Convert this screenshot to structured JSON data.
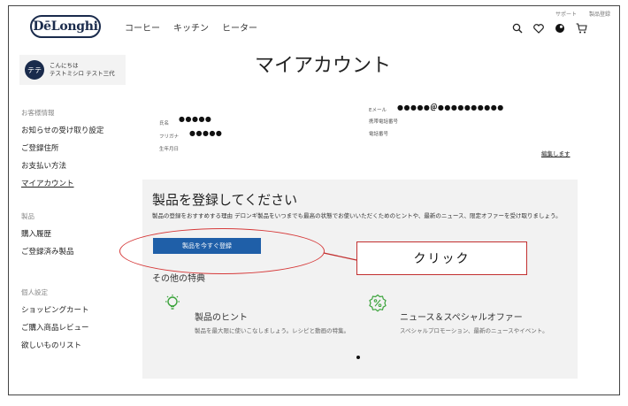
{
  "header": {
    "logo": "DēLonghi",
    "nav": [
      "コーヒー",
      "キッチン",
      "ヒーター"
    ],
    "top_links": [
      "サポート",
      "製品登録"
    ]
  },
  "sidebar": {
    "greeting": {
      "avatar": "テテ",
      "line1": "こんにちは",
      "line2": "テストミシロ テスト三代"
    },
    "sections": [
      {
        "title": "お客様情報",
        "items": [
          "お知らせの受け取り設定",
          "ご登録住所",
          "お支払い方法",
          "マイアカウント"
        ]
      },
      {
        "title": "製品",
        "items": [
          "購入履歴",
          "ご登録済み製品"
        ]
      },
      {
        "title": "個人設定",
        "items": [
          "ショッピングカート",
          "ご購入商品レビュー",
          "欲しいものリスト"
        ]
      }
    ]
  },
  "account": {
    "title": "マイアカウント",
    "name_label": "氏名",
    "name_value": "●●●●●",
    "kana_label": "フリガナ",
    "kana_value": "●●●●●",
    "birth_label": "生年月日",
    "email_label": "Eメール",
    "email_value": "●●●●●＠●●●●●●●●●●",
    "mobile_label": "携帯電話番号",
    "phone_label": "電話番号",
    "edit_label": "編集します"
  },
  "register": {
    "title": "製品を登録してください",
    "description": "製品の登録をおすすめする理由 デロンギ製品をいつまでも最高の状態でお使いいただくためのヒントや、最新のニュース、限定オファーを受け取りましょう。",
    "button_label": "製品を今すぐ登録",
    "benefits_title": "その他の特典",
    "benefits": [
      {
        "icon": "lightbulb-icon",
        "title": "製品のヒント",
        "desc": "製品を最大限に使いこなしましょう。レシピと動画の特集。"
      },
      {
        "icon": "percent-badge-icon",
        "title": "ニュース＆スペシャルオファー",
        "desc": "スペシャルプロモーション、最新のニュースやイベント。"
      }
    ]
  },
  "annotation": {
    "callout_text": "クリック",
    "color": "#c23030"
  },
  "colors": {
    "brand": "#1a2b4c",
    "button": "#1f5fa8",
    "perk_icon": "#3aa33a"
  }
}
